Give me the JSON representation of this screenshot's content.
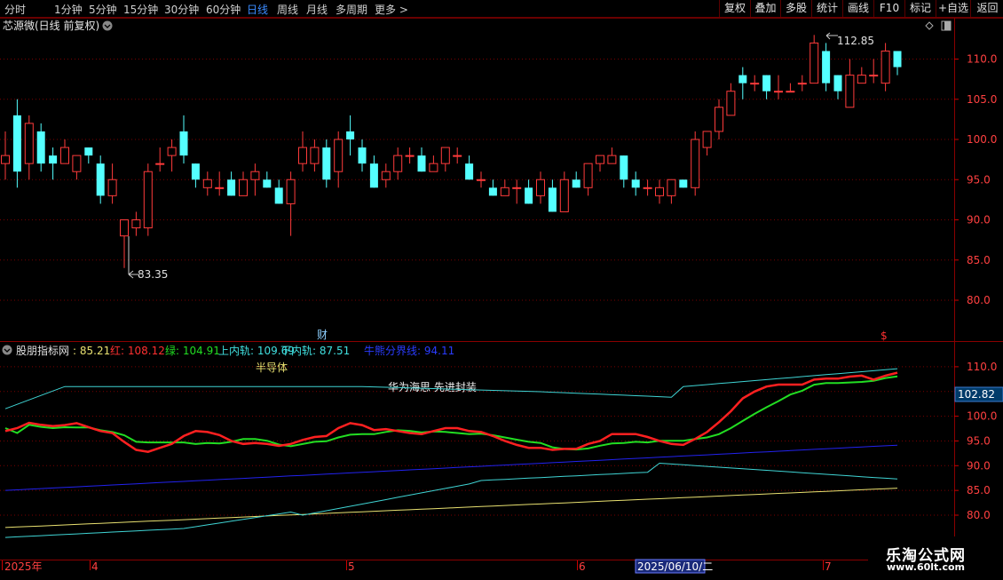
{
  "toolbar": {
    "periods": [
      "分时",
      "1分钟",
      "5分钟",
      "15分钟",
      "30分钟",
      "60分钟",
      "日线",
      "周线",
      "月线",
      "多周期",
      "更多 >"
    ],
    "active": "日线",
    "right": [
      "复权",
      "叠加",
      "多股",
      "统计",
      "画线",
      "F10",
      "标记",
      "+自选",
      "返回"
    ]
  },
  "chart_header": {
    "title": "芯源微(日线 前复权)"
  },
  "price_axis": [
    "110.0",
    "105.0",
    "100.0",
    "95.0",
    "90.0",
    "85.0",
    "80.0"
  ],
  "annotations": {
    "high": "112.85",
    "low": "83.35",
    "cai": "财",
    "dollar": "$"
  },
  "indicator": {
    "name": "股朋指标网",
    "v1": ": 85.21",
    "red_label": "红: 108.12",
    "green_label": "绿: 104.91",
    "upper_label": "上内轨: 109.69",
    "lower_label": "下内轨: 87.51",
    "div_label": "牛熊分界线: 94.11",
    "text1": "半导体",
    "text2": "华为海思 先进封装",
    "axis": [
      "110.0",
      "105.0",
      "100.0",
      "95.0",
      "90.0",
      "85.0",
      "80.0"
    ],
    "last_value": "102.82"
  },
  "time_axis": {
    "labels": [
      "2025年",
      "4",
      "5",
      "6",
      "7"
    ],
    "cursor": "2025/06/10/二"
  },
  "watermark": {
    "line1": "乐淘公式网",
    "line2": "www.60lt.com"
  },
  "colors": {
    "up": "#ff3b3b",
    "down": "#54ffff",
    "red_line": "#ff2020",
    "green_line": "#22dd22",
    "band": "#3fd4d4",
    "div_line": "#2222ee",
    "yellow_line": "#e8e070"
  },
  "chart_data": {
    "type": "candlestick",
    "title": "芯源微(日线 前复权)",
    "ylim": [
      77,
      115
    ],
    "candles": [
      [
        97,
        98,
        95,
        101
      ],
      [
        103,
        96,
        94,
        105
      ],
      [
        97,
        102,
        95,
        103
      ],
      [
        101,
        97,
        96,
        102
      ],
      [
        98,
        97,
        95,
        99
      ],
      [
        97,
        99,
        97,
        100
      ],
      [
        96,
        98,
        95,
        98
      ],
      [
        99,
        98,
        97,
        99
      ],
      [
        97,
        93,
        92,
        98
      ],
      [
        93,
        95,
        92,
        97
      ],
      [
        88,
        90,
        84,
        90
      ],
      [
        89,
        90,
        88,
        91
      ],
      [
        89,
        96,
        88,
        97
      ],
      [
        97,
        97,
        96,
        99
      ],
      [
        98,
        99,
        96,
        100
      ],
      [
        101,
        98,
        97,
        103
      ],
      [
        97,
        95,
        94,
        97
      ],
      [
        94,
        95,
        93,
        96
      ],
      [
        94,
        94,
        93,
        96
      ],
      [
        95,
        93,
        93,
        96
      ],
      [
        93,
        95,
        93,
        96
      ],
      [
        95,
        96,
        93,
        97
      ],
      [
        95,
        94,
        94,
        96
      ],
      [
        94,
        92,
        92,
        95
      ],
      [
        92,
        95,
        88,
        96
      ],
      [
        97,
        99,
        96,
        101
      ],
      [
        97,
        99,
        96,
        100
      ],
      [
        99,
        95,
        94,
        100
      ],
      [
        96,
        100,
        94,
        101
      ],
      [
        101,
        100,
        98,
        103
      ],
      [
        99,
        97,
        96,
        100
      ],
      [
        97,
        94,
        94,
        98
      ],
      [
        95,
        96,
        94,
        97
      ],
      [
        96,
        98,
        95,
        99
      ],
      [
        98,
        98,
        97,
        99
      ],
      [
        98,
        96,
        96,
        99
      ],
      [
        96,
        97,
        96,
        98
      ],
      [
        97,
        99,
        96,
        99
      ],
      [
        98,
        98,
        97,
        99
      ],
      [
        97,
        95,
        95,
        98
      ],
      [
        95,
        95,
        94,
        96
      ],
      [
        94,
        93,
        93,
        95
      ],
      [
        93,
        94,
        93,
        95
      ],
      [
        94,
        94,
        92,
        95
      ],
      [
        94,
        92,
        92,
        95
      ],
      [
        93,
        95,
        92,
        96
      ],
      [
        94,
        91,
        91,
        95
      ],
      [
        91,
        95,
        91,
        96
      ],
      [
        95,
        94,
        94,
        96
      ],
      [
        94,
        97,
        93,
        97
      ],
      [
        97,
        98,
        96,
        98
      ],
      [
        97,
        98,
        97,
        99
      ],
      [
        98,
        95,
        94,
        98
      ],
      [
        95,
        94,
        93,
        96
      ],
      [
        94,
        94,
        93,
        95
      ],
      [
        93,
        94,
        92,
        95
      ],
      [
        93,
        95,
        92,
        95
      ],
      [
        95,
        94,
        94,
        95
      ],
      [
        94,
        100,
        93,
        101
      ],
      [
        99,
        101,
        98,
        101
      ],
      [
        101,
        104,
        100,
        105
      ],
      [
        103,
        106,
        103,
        107
      ],
      [
        108,
        107,
        105,
        109
      ],
      [
        107,
        107,
        106,
        108
      ],
      [
        108,
        106,
        105,
        108
      ],
      [
        106,
        106,
        105,
        108
      ],
      [
        106,
        106,
        106,
        107
      ],
      [
        107,
        107,
        106,
        108
      ],
      [
        107,
        112,
        107,
        113
      ],
      [
        111,
        107,
        106,
        112
      ],
      [
        108,
        106,
        105,
        108
      ],
      [
        104,
        108,
        104,
        110
      ],
      [
        107,
        108,
        107,
        109
      ],
      [
        108,
        108,
        107,
        110
      ],
      [
        107,
        111,
        106,
        112
      ],
      [
        111,
        109,
        108,
        111
      ]
    ],
    "indicator_series": [
      {
        "name": "红",
        "color": "#ff2020"
      },
      {
        "name": "绿",
        "color": "#22dd22"
      },
      {
        "name": "上内轨",
        "color": "#3fd4d4"
      },
      {
        "name": "下内轨",
        "color": "#3fd4d4"
      },
      {
        "name": "牛熊分界线",
        "color": "#2222ee"
      }
    ]
  }
}
